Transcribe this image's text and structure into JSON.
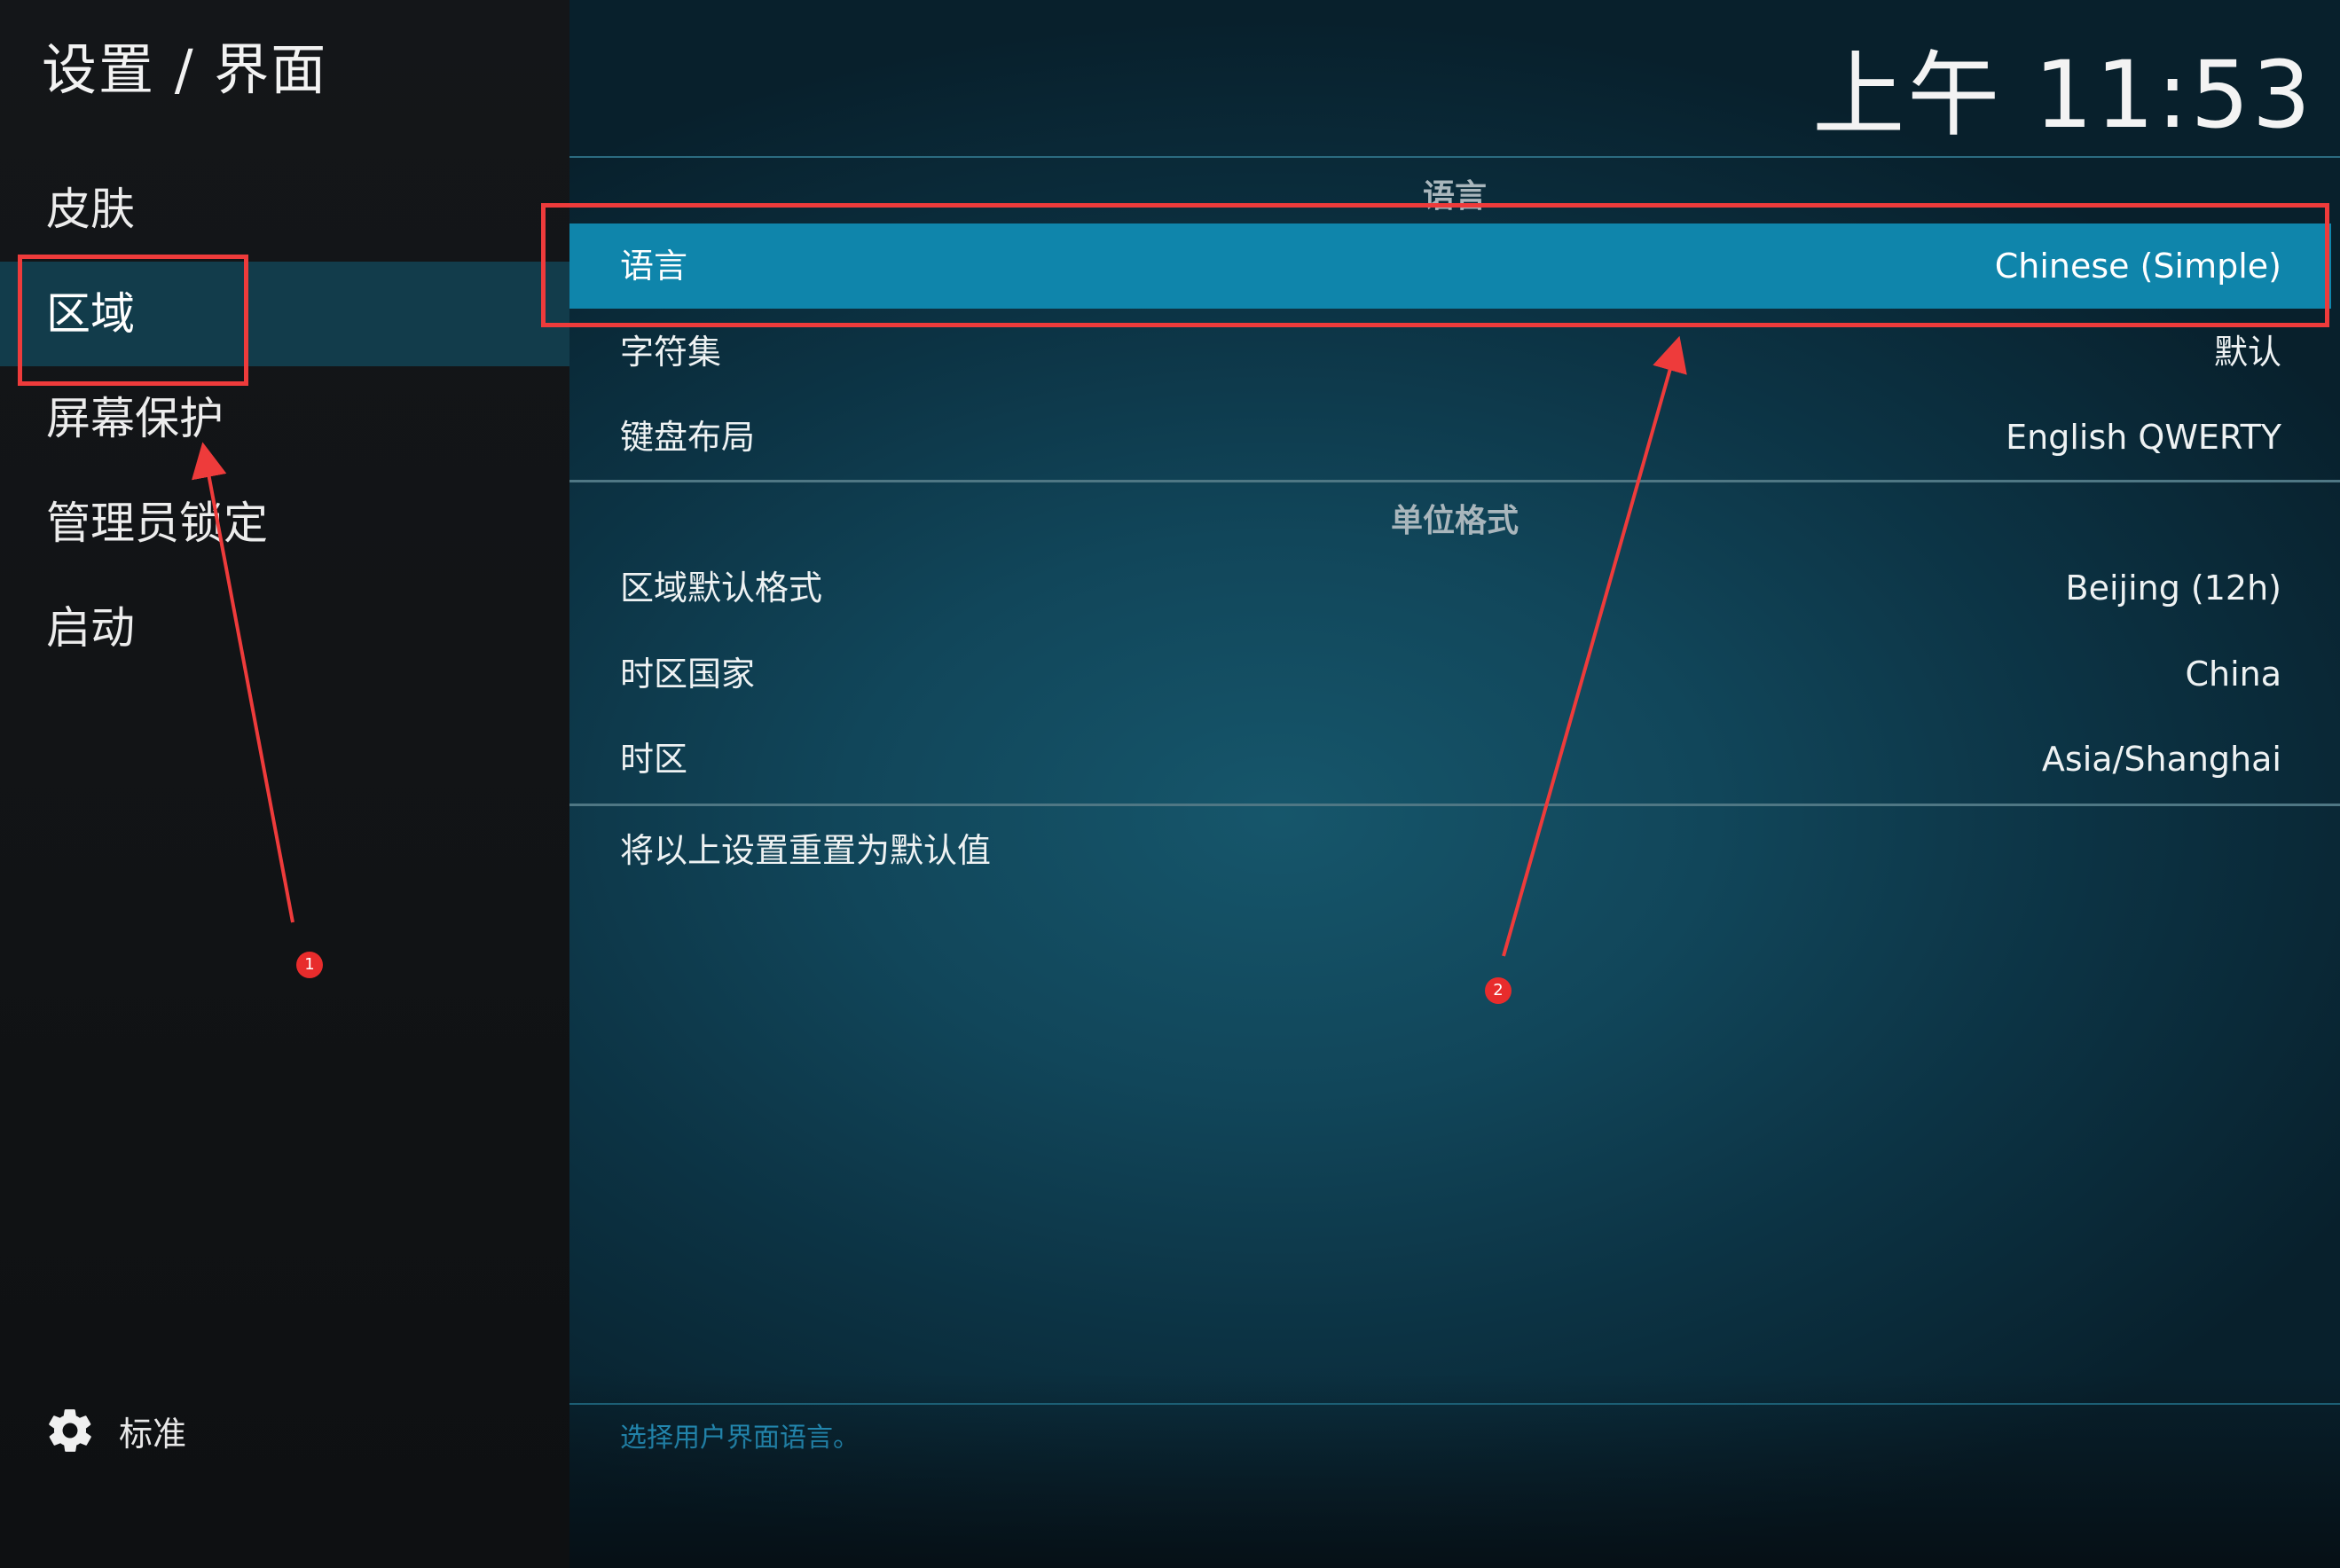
{
  "header": {
    "breadcrumb": "设置 / 界面",
    "clock": "上午 11:53"
  },
  "sidebar": {
    "items": [
      {
        "label": "皮肤"
      },
      {
        "label": "区域"
      },
      {
        "label": "屏幕保护"
      },
      {
        "label": "管理员锁定"
      },
      {
        "label": "启动"
      }
    ],
    "selected_index": 1,
    "footer": {
      "icon": "gear-icon",
      "label": "标准"
    }
  },
  "main": {
    "sections": [
      {
        "header": "语言",
        "rows": [
          {
            "label": "语言",
            "value": "Chinese (Simple)"
          },
          {
            "label": "字符集",
            "value": "默认"
          },
          {
            "label": "键盘布局",
            "value": "English QWERTY"
          }
        ]
      },
      {
        "header": "单位格式",
        "rows": [
          {
            "label": "区域默认格式",
            "value": "Beijing (12h)"
          },
          {
            "label": "时区国家",
            "value": "China"
          },
          {
            "label": "时区",
            "value": "Asia/Shanghai"
          }
        ]
      }
    ],
    "reset_label": "将以上设置重置为默认值",
    "hint": "选择用户界面语言。"
  },
  "annotations": {
    "badge_1": "1",
    "badge_2": "2"
  },
  "colors": {
    "accent": "#0f85ab",
    "sidebar_selected": "#123c4b",
    "annotation": "#ee3b3b",
    "hint": "#2aa7d8"
  }
}
